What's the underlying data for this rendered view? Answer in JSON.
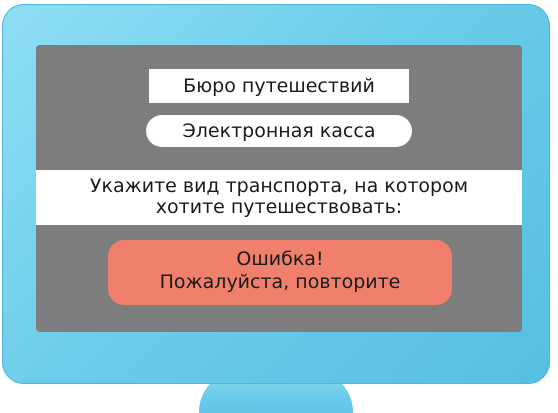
{
  "screen": {
    "title": "Бюро путешествий",
    "subtitle": "Электронная касса",
    "prompt": {
      "line1": "Укажите вид транспорта, на котором",
      "line2": "хотите путешествовать:"
    },
    "error": {
      "line1": "Ошибка!",
      "line2": "Пожалуйста, повторите"
    }
  },
  "colors": {
    "bezel": "#6dcdea",
    "screen": "#7d7d7d",
    "panel": "#ffffff",
    "error": "#f0806b"
  }
}
